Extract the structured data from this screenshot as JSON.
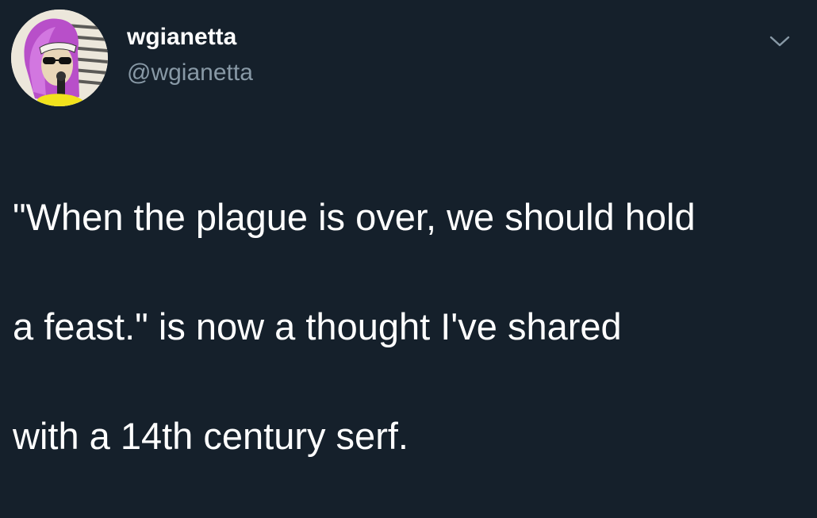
{
  "user": {
    "display_name": "wgianetta",
    "handle": "@wgianetta",
    "avatar_icon": "profile-avatar-illustration"
  },
  "menu_icon": "chevron-down-icon",
  "tweet": {
    "text_lines": [
      "\"When the plague is over, we should hold",
      "a feast.\" is now a thought I've shared",
      "with a 14th century serf."
    ]
  },
  "colors": {
    "background": "#15202b",
    "primary_text": "#ffffff",
    "secondary_text": "#8899a6"
  }
}
